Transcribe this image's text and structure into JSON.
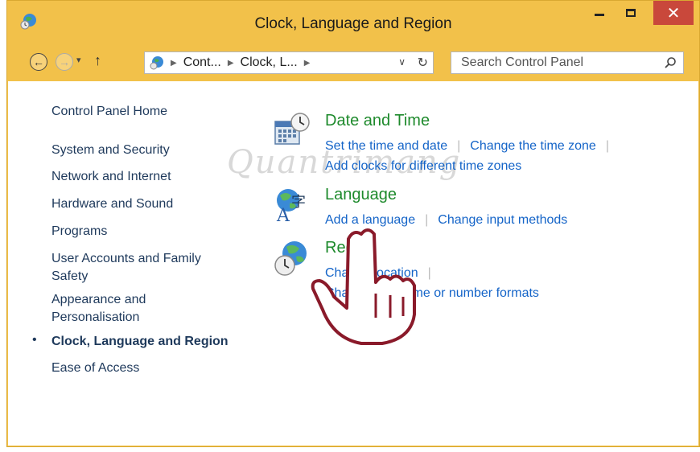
{
  "window": {
    "title": "Clock, Language and Region",
    "close_glyph": "✕"
  },
  "nav": {
    "back_glyph": "←",
    "forward_glyph": "→",
    "recent_glyph": "▾",
    "up_glyph": "↑",
    "breadcrumbs": [
      "Cont...",
      "Clock, L..."
    ],
    "dropdown_glyph": "∨",
    "refresh_glyph": "↻",
    "search_placeholder": "Search Control Panel"
  },
  "sidebar": {
    "items": [
      {
        "label": "Control Panel Home"
      },
      {
        "label": "System and Security"
      },
      {
        "label": "Network and Internet"
      },
      {
        "label": "Hardware and Sound"
      },
      {
        "label": "Programs"
      },
      {
        "label": "User Accounts and Family Safety"
      },
      {
        "label": "Appearance and Personalisation"
      },
      {
        "label": "Clock, Language and Region",
        "active": true
      },
      {
        "label": "Ease of Access"
      }
    ],
    "bullet": "•"
  },
  "categories": [
    {
      "title": "Date and Time",
      "icon": "calendar-clock-icon",
      "links": [
        "Set the time and date",
        "Change the time zone",
        "Add clocks for different time zones"
      ]
    },
    {
      "title": "Language",
      "icon": "language-globe-icon",
      "links": [
        "Add a language",
        "Change input methods"
      ]
    },
    {
      "title": "Region",
      "icon": "region-globe-clock-icon",
      "links": [
        "Change location",
        "Change date, time or number formats"
      ]
    }
  ],
  "watermark": "Quantrimang",
  "colors": {
    "frame": "#f2c14a",
    "close": "#c9483b",
    "link": "#1464c8",
    "heading": "#1e8a2c",
    "nav_text": "#1e395b"
  }
}
